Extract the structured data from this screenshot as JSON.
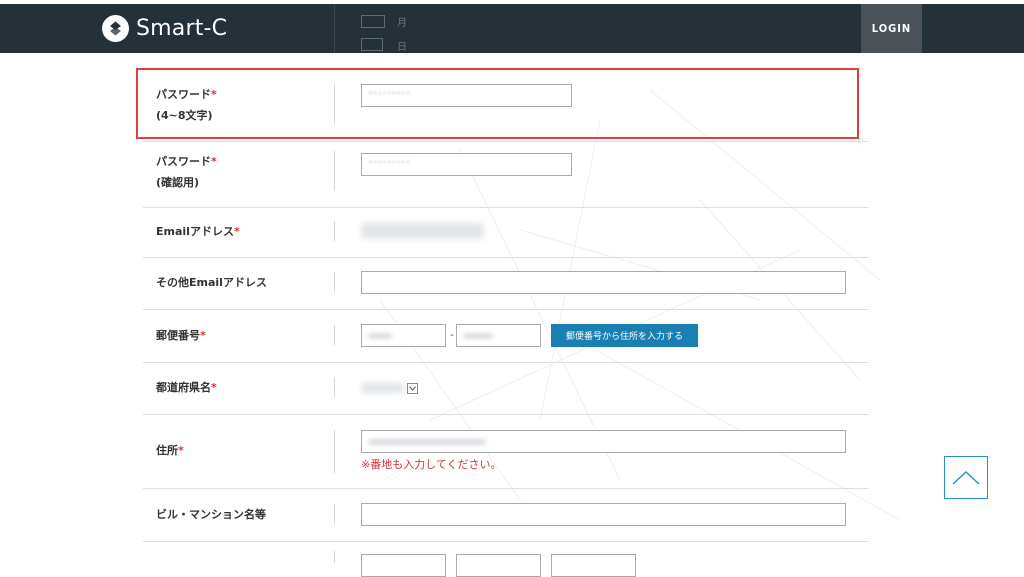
{
  "header": {
    "logo_text": "Smart-C",
    "login_label": "LOGIN",
    "ghost_month": "月",
    "ghost_day": "日"
  },
  "form": {
    "password": {
      "label": "パスワード",
      "required_mark": "*",
      "hint": "(4~8文字)",
      "masked_value": "•••••••••"
    },
    "password_confirm": {
      "label": "パスワード",
      "required_mark": "*",
      "hint": "(確認用)",
      "masked_value": "•••••••••"
    },
    "email": {
      "label": "Emailアドレス",
      "required_mark": "*"
    },
    "other_email": {
      "label": "その他Emailアドレス",
      "value": ""
    },
    "zip": {
      "label": "郵便番号",
      "required_mark": "*",
      "separator": "-",
      "lookup_button": "郵便番号から住所を入力する"
    },
    "prefecture": {
      "label": "都道府県名",
      "required_mark": "*"
    },
    "address": {
      "label": "住所",
      "required_mark": "*",
      "note": "※番地も入力してください。"
    },
    "building": {
      "label": "ビル・マンション名等",
      "value": ""
    }
  },
  "colors": {
    "header_bg": "#243139",
    "login_bg": "#4a5257",
    "required": "#d9323a",
    "button_blue": "#1a7fb3",
    "highlight": "#e53a3a",
    "scroll_top_border": "#2d8fc9"
  },
  "icons": {
    "logo": "smart-c-logo-icon",
    "scroll_top": "chevron-up-icon",
    "select": "chevron-down-icon"
  }
}
